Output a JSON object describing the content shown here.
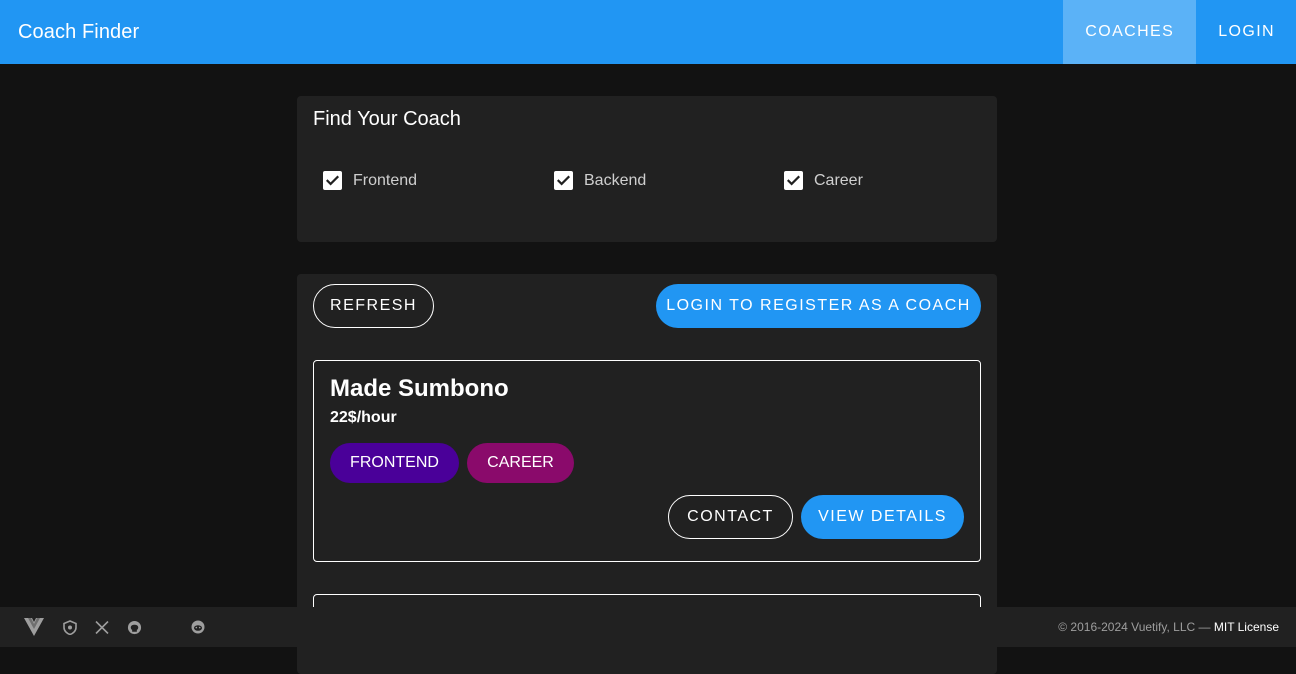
{
  "app": {
    "title": "Coach Finder"
  },
  "nav": {
    "coaches": "Coaches",
    "login": "Login"
  },
  "filter": {
    "title": "Find Your Coach",
    "options": [
      {
        "label": "Frontend",
        "checked": true
      },
      {
        "label": "Backend",
        "checked": true
      },
      {
        "label": "Career",
        "checked": true
      }
    ]
  },
  "actions": {
    "refresh": "Refresh",
    "register": "Login to Register as a Coach"
  },
  "coaches": [
    {
      "name": "Made Sumbono",
      "rate": "22$/hour",
      "areas": [
        {
          "label": "Frontend",
          "color": "#4A0099"
        },
        {
          "label": "Career",
          "color": "#8A0A6B"
        }
      ],
      "contact": "Contact",
      "details": "View Details"
    }
  ],
  "footer": {
    "icons": [
      "vuetify-logo-icon",
      "shield-icon",
      "x-twitter-icon",
      "github-icon",
      "reddit-icon"
    ],
    "copyright": "© 2016-2024 Vuetify, LLC —",
    "license": "MIT License"
  },
  "colors": {
    "primary": "#2196F3",
    "nav_active": "#5BB2F7",
    "surface": "#212121",
    "background": "#121212"
  }
}
